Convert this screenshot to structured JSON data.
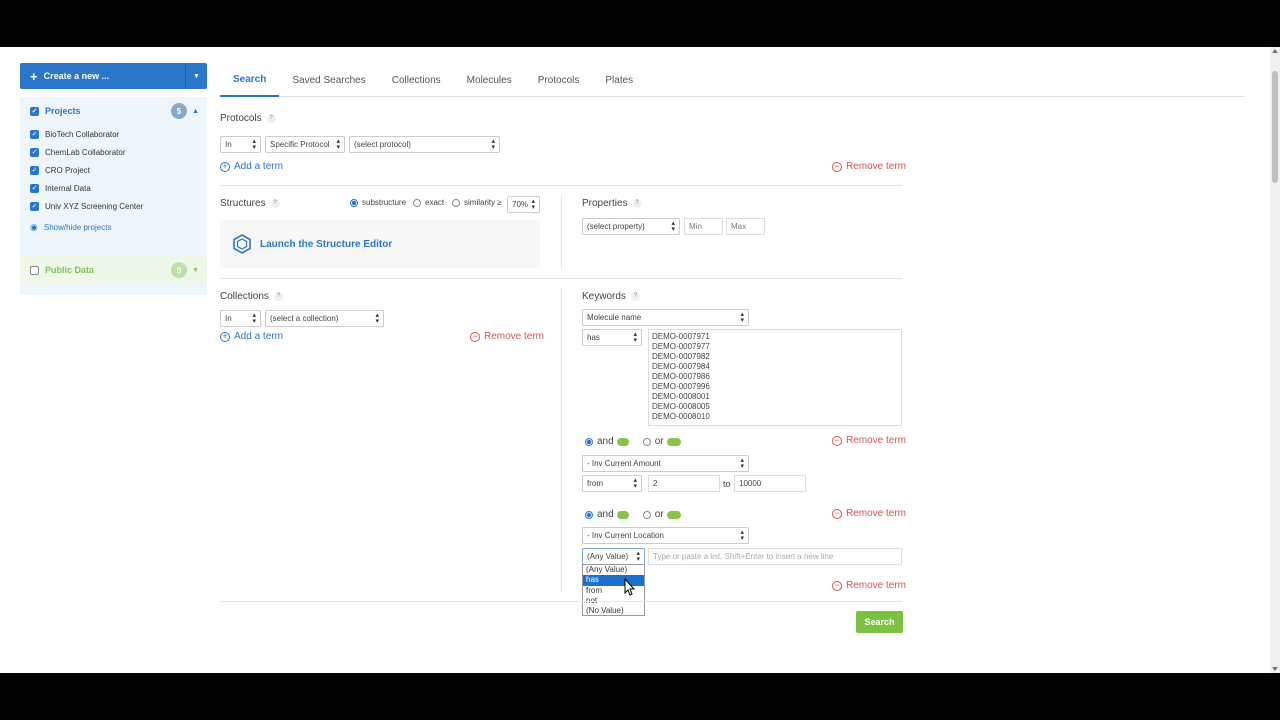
{
  "sidebar": {
    "create_label": "Create a new ...",
    "projects_label": "Projects",
    "projects_count": "5",
    "projects": [
      {
        "label": "BioTech Collaborator",
        "checked": true
      },
      {
        "label": "ChemLab Collaborator",
        "checked": true
      },
      {
        "label": "CRO Project",
        "checked": true
      },
      {
        "label": "Internal Data",
        "checked": true
      },
      {
        "label": "Univ XYZ Screening Center",
        "checked": true
      }
    ],
    "show_hide": "Show/hide projects",
    "public_label": "Public Data",
    "public_count": "0"
  },
  "tabs": [
    "Search",
    "Saved Searches",
    "Collections",
    "Molecules",
    "Protocols",
    "Plates"
  ],
  "active_tab": "Search",
  "protocols": {
    "label": "Protocols",
    "in": "In",
    "type": "Specific Protocol",
    "protocol": "(select protocol)",
    "add_term": "Add a term",
    "remove_term": "Remove term"
  },
  "structures": {
    "label": "Structures",
    "opt_substructure": "substructure",
    "opt_exact": "exact",
    "opt_similarity": "similarity ≥",
    "similarity_value": "70%",
    "selected": "substructure",
    "launch": "Launch the Structure Editor"
  },
  "properties": {
    "label": "Properties",
    "property": "(select property)",
    "min_placeholder": "Min",
    "max_placeholder": "Max"
  },
  "collections": {
    "label": "Collections",
    "in": "In",
    "collection": "(select a collection)",
    "add_term": "Add a term",
    "remove_term": "Remove term"
  },
  "keywords": {
    "label": "Keywords",
    "field1": "Molecule name",
    "op1": "has",
    "values": [
      "DEMO-0007971",
      "DEMO-0007977",
      "DEMO-0007982",
      "DEMO-0007984",
      "DEMO-0007986",
      "DEMO-0007996",
      "DEMO-0008001",
      "DEMO-0008005",
      "DEMO-0008010"
    ],
    "and_label": "and",
    "or_label": "or",
    "remove_term": "Remove term",
    "field2": "- Inv Current Amount",
    "op2": "from",
    "from_value": "2",
    "to_label": "to",
    "to_value": "10000",
    "field3": "- Inv Current Location",
    "op3": "(Any Value)",
    "list_placeholder": "Type or paste a list, Shift+Enter to insert a new line",
    "dropdown_options": [
      "(Any Value)",
      "has",
      "from",
      "not",
      "(No Value)"
    ],
    "dropdown_highlight": "has"
  },
  "search_button": "Search"
}
